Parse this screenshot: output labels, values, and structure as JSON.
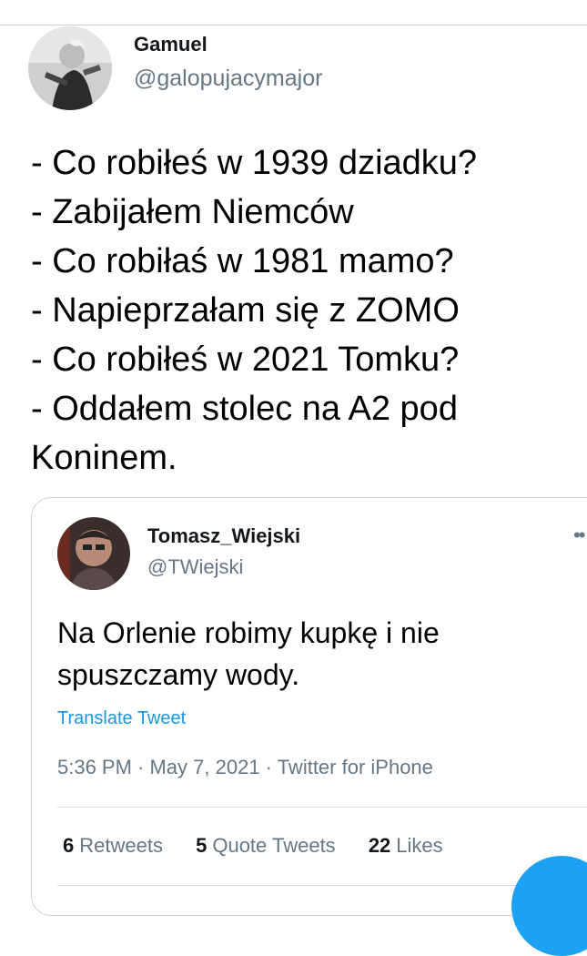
{
  "tweet": {
    "author_name": "Gamuel",
    "author_handle": "@galopujacymajor",
    "text_lines": [
      "- Co robiłeś w 1939 dziadku?",
      "- Zabijałem Niemców",
      "- Co robiłaś w 1981 mamo?",
      "- Napieprzałam się z ZOMO",
      "- Co robiłeś w 2021 Tomku?",
      "- Oddałem stolec na A2 pod",
      "Koninem."
    ]
  },
  "quoted_tweet": {
    "author_name": "Tomasz_Wiejski",
    "author_handle": "@TWiejski",
    "more_icon": "ellipsis-icon",
    "text_lines": [
      "Na Orlenie robimy kupkę i nie",
      "spuszczamy wody."
    ],
    "translate_label": "Translate Tweet",
    "timestamp": "5:36 PM · May 7, 2021 · Twitter for iPhone",
    "stats": {
      "retweets_count": "6",
      "retweets_label": "Retweets",
      "quotes_count": "5",
      "quotes_label": "Quote Tweets",
      "likes_count": "22",
      "likes_label": "Likes"
    }
  },
  "colors": {
    "accent": "#1da1f2",
    "link": "#1b95e0",
    "secondary_text": "#657786",
    "border": "#c9d1d6"
  }
}
